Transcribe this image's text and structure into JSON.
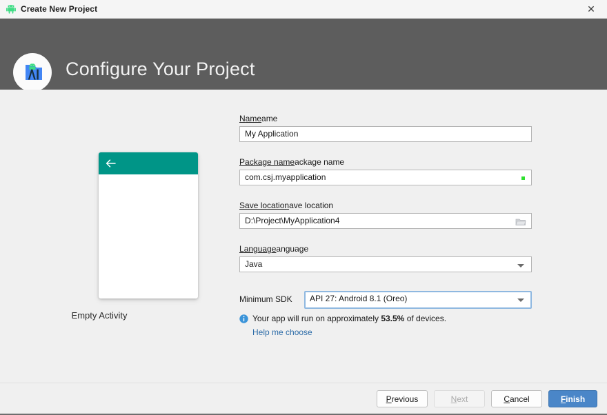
{
  "titlebar": {
    "title": "Create New Project",
    "icon": "android-robot-icon",
    "close_label": "✕"
  },
  "header": {
    "title": "Configure Your Project",
    "logo": "android-studio-logo"
  },
  "preview": {
    "label": "Empty Activity",
    "back_icon": "arrow-left-icon",
    "appbar_color": "#009587"
  },
  "form": {
    "name": {
      "label": "Name",
      "mnemonic": "N",
      "value": "My Application"
    },
    "package": {
      "label": "Package name",
      "mnemonic": "P",
      "value": "com.csj.myapplication",
      "validity": "valid",
      "validity_color": "#2ee02e"
    },
    "save_location": {
      "label": "Save location",
      "mnemonic": "S",
      "value": "D:\\Project\\MyApplication4",
      "browse_icon": "folder-icon"
    },
    "language": {
      "label": "Language",
      "mnemonic": "L",
      "value": "Java",
      "dropdown_icon": "chevron-down-icon"
    },
    "minimum_sdk": {
      "label": "Minimum SDK",
      "value": "API 27: Android 8.1 (Oreo)",
      "dropdown_icon": "chevron-down-icon",
      "focused": true
    },
    "devices": {
      "icon": "info-icon",
      "text_before": "Your app will run on approximately ",
      "percent": "53.5%",
      "text_after": " of devices.",
      "help_link": "Help me choose",
      "link_color": "#2d6ca8"
    }
  },
  "footer": {
    "previous_label": "Previous",
    "previous_mnemonic": "P",
    "next_label": "Next",
    "next_mnemonic": "N",
    "next_enabled": false,
    "cancel_label": "Cancel",
    "cancel_mnemonic": "C",
    "finish_label": "Finish",
    "finish_mnemonic": "F",
    "finish_color": "#4a86c8"
  }
}
